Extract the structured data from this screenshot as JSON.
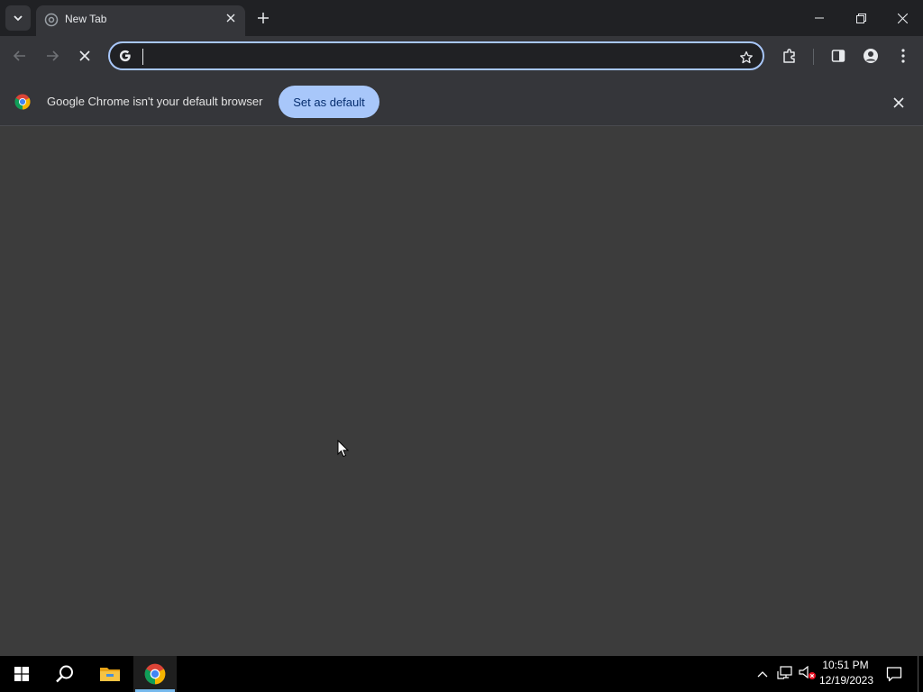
{
  "browser": {
    "tab": {
      "title": "New Tab",
      "favicon": "chrome-newtab-icon"
    },
    "omnibox": {
      "value": "",
      "placeholder": ""
    },
    "infobar": {
      "message": "Google Chrome isn't your default browser",
      "button_label": "Set as default"
    }
  },
  "taskbar": {
    "clock": {
      "time": "10:51 PM",
      "date": "12/19/2023"
    },
    "apps": [
      "windows-start-icon",
      "search-icon",
      "file-explorer-icon",
      "chrome-icon"
    ]
  },
  "colors": {
    "accent": "#a8c7fa",
    "tabstrip": "#202124",
    "toolbar": "#35363a",
    "content": "#3c3c3c"
  }
}
